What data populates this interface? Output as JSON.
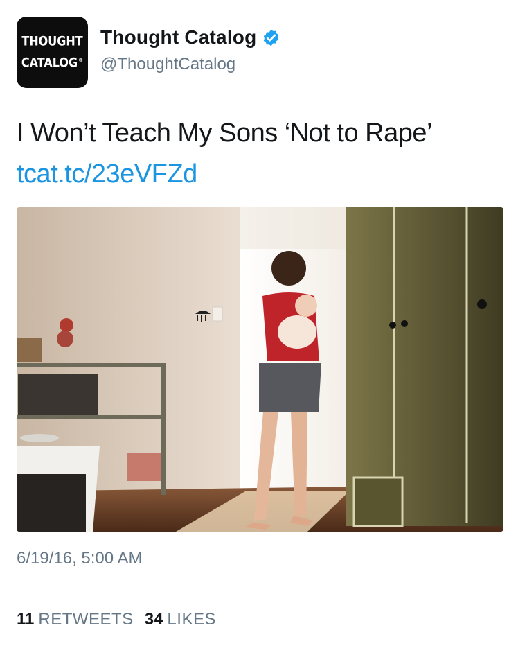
{
  "author": {
    "avatar_line1": "THOUGHT",
    "avatar_line2": "CATALOG",
    "avatar_mark": "®",
    "display_name": "Thought Catalog",
    "handle": "@ThoughtCatalog",
    "verified_icon": "verified-badge-icon",
    "verified_color": "#1da1f2"
  },
  "tweet": {
    "text": "I Won’t Teach My Sons ‘Not to Rape’",
    "link": "tcat.tc/23eVFZd",
    "link_color": "#1b95e0",
    "timestamp": "6/19/16, 5:00 AM"
  },
  "stats": {
    "retweets_count": "11",
    "retweets_label": "RETWEETS",
    "likes_count": "34",
    "likes_label": "LIKES"
  }
}
